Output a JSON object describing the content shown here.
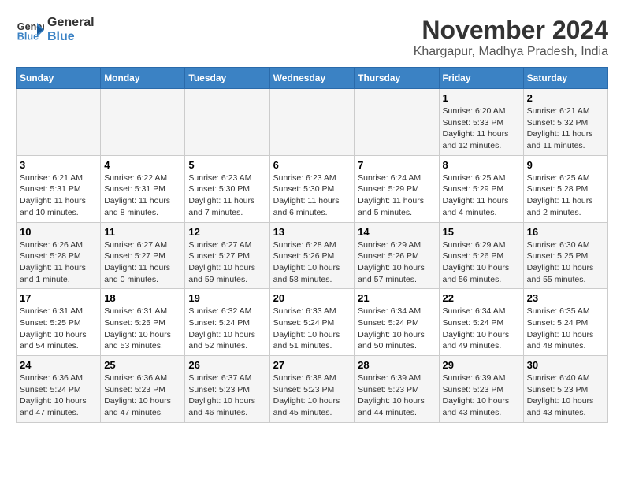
{
  "header": {
    "logo_line1": "General",
    "logo_line2": "Blue",
    "title": "November 2024",
    "subtitle": "Khargapur, Madhya Pradesh, India"
  },
  "days_of_week": [
    "Sunday",
    "Monday",
    "Tuesday",
    "Wednesday",
    "Thursday",
    "Friday",
    "Saturday"
  ],
  "weeks": [
    [
      {
        "day": "",
        "detail": ""
      },
      {
        "day": "",
        "detail": ""
      },
      {
        "day": "",
        "detail": ""
      },
      {
        "day": "",
        "detail": ""
      },
      {
        "day": "",
        "detail": ""
      },
      {
        "day": "1",
        "detail": "Sunrise: 6:20 AM\nSunset: 5:33 PM\nDaylight: 11 hours and 12 minutes."
      },
      {
        "day": "2",
        "detail": "Sunrise: 6:21 AM\nSunset: 5:32 PM\nDaylight: 11 hours and 11 minutes."
      }
    ],
    [
      {
        "day": "3",
        "detail": "Sunrise: 6:21 AM\nSunset: 5:31 PM\nDaylight: 11 hours and 10 minutes."
      },
      {
        "day": "4",
        "detail": "Sunrise: 6:22 AM\nSunset: 5:31 PM\nDaylight: 11 hours and 8 minutes."
      },
      {
        "day": "5",
        "detail": "Sunrise: 6:23 AM\nSunset: 5:30 PM\nDaylight: 11 hours and 7 minutes."
      },
      {
        "day": "6",
        "detail": "Sunrise: 6:23 AM\nSunset: 5:30 PM\nDaylight: 11 hours and 6 minutes."
      },
      {
        "day": "7",
        "detail": "Sunrise: 6:24 AM\nSunset: 5:29 PM\nDaylight: 11 hours and 5 minutes."
      },
      {
        "day": "8",
        "detail": "Sunrise: 6:25 AM\nSunset: 5:29 PM\nDaylight: 11 hours and 4 minutes."
      },
      {
        "day": "9",
        "detail": "Sunrise: 6:25 AM\nSunset: 5:28 PM\nDaylight: 11 hours and 2 minutes."
      }
    ],
    [
      {
        "day": "10",
        "detail": "Sunrise: 6:26 AM\nSunset: 5:28 PM\nDaylight: 11 hours and 1 minute."
      },
      {
        "day": "11",
        "detail": "Sunrise: 6:27 AM\nSunset: 5:27 PM\nDaylight: 11 hours and 0 minutes."
      },
      {
        "day": "12",
        "detail": "Sunrise: 6:27 AM\nSunset: 5:27 PM\nDaylight: 10 hours and 59 minutes."
      },
      {
        "day": "13",
        "detail": "Sunrise: 6:28 AM\nSunset: 5:26 PM\nDaylight: 10 hours and 58 minutes."
      },
      {
        "day": "14",
        "detail": "Sunrise: 6:29 AM\nSunset: 5:26 PM\nDaylight: 10 hours and 57 minutes."
      },
      {
        "day": "15",
        "detail": "Sunrise: 6:29 AM\nSunset: 5:26 PM\nDaylight: 10 hours and 56 minutes."
      },
      {
        "day": "16",
        "detail": "Sunrise: 6:30 AM\nSunset: 5:25 PM\nDaylight: 10 hours and 55 minutes."
      }
    ],
    [
      {
        "day": "17",
        "detail": "Sunrise: 6:31 AM\nSunset: 5:25 PM\nDaylight: 10 hours and 54 minutes."
      },
      {
        "day": "18",
        "detail": "Sunrise: 6:31 AM\nSunset: 5:25 PM\nDaylight: 10 hours and 53 minutes."
      },
      {
        "day": "19",
        "detail": "Sunrise: 6:32 AM\nSunset: 5:24 PM\nDaylight: 10 hours and 52 minutes."
      },
      {
        "day": "20",
        "detail": "Sunrise: 6:33 AM\nSunset: 5:24 PM\nDaylight: 10 hours and 51 minutes."
      },
      {
        "day": "21",
        "detail": "Sunrise: 6:34 AM\nSunset: 5:24 PM\nDaylight: 10 hours and 50 minutes."
      },
      {
        "day": "22",
        "detail": "Sunrise: 6:34 AM\nSunset: 5:24 PM\nDaylight: 10 hours and 49 minutes."
      },
      {
        "day": "23",
        "detail": "Sunrise: 6:35 AM\nSunset: 5:24 PM\nDaylight: 10 hours and 48 minutes."
      }
    ],
    [
      {
        "day": "24",
        "detail": "Sunrise: 6:36 AM\nSunset: 5:24 PM\nDaylight: 10 hours and 47 minutes."
      },
      {
        "day": "25",
        "detail": "Sunrise: 6:36 AM\nSunset: 5:23 PM\nDaylight: 10 hours and 47 minutes."
      },
      {
        "day": "26",
        "detail": "Sunrise: 6:37 AM\nSunset: 5:23 PM\nDaylight: 10 hours and 46 minutes."
      },
      {
        "day": "27",
        "detail": "Sunrise: 6:38 AM\nSunset: 5:23 PM\nDaylight: 10 hours and 45 minutes."
      },
      {
        "day": "28",
        "detail": "Sunrise: 6:39 AM\nSunset: 5:23 PM\nDaylight: 10 hours and 44 minutes."
      },
      {
        "day": "29",
        "detail": "Sunrise: 6:39 AM\nSunset: 5:23 PM\nDaylight: 10 hours and 43 minutes."
      },
      {
        "day": "30",
        "detail": "Sunrise: 6:40 AM\nSunset: 5:23 PM\nDaylight: 10 hours and 43 minutes."
      }
    ]
  ]
}
